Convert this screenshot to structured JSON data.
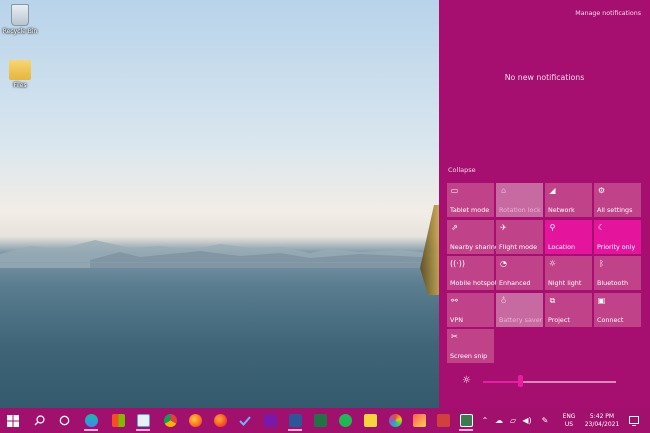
{
  "desktop": {
    "icons": [
      {
        "label": "Recycle Bin"
      },
      {
        "label": "Files"
      }
    ]
  },
  "action_center": {
    "manage_link": "Manage notifications",
    "empty_message": "No new notifications",
    "collapse_label": "Collapse",
    "tiles": [
      {
        "label": "Tablet mode",
        "icon": "tablet-mode-icon",
        "state": "off"
      },
      {
        "label": "Rotation lock",
        "icon": "rotation-lock-icon",
        "state": "disabled"
      },
      {
        "label": "Network",
        "icon": "network-icon",
        "state": "off"
      },
      {
        "label": "All settings",
        "icon": "gear-icon",
        "state": "off"
      },
      {
        "label": "Nearby sharing",
        "icon": "nearby-sharing-icon",
        "state": "off"
      },
      {
        "label": "Flight mode",
        "icon": "airplane-icon",
        "state": "off"
      },
      {
        "label": "Location",
        "icon": "location-icon",
        "state": "on"
      },
      {
        "label": "Priority only",
        "icon": "moon-icon",
        "state": "on"
      },
      {
        "label": "Mobile hotspot",
        "icon": "hotspot-icon",
        "state": "off"
      },
      {
        "label": "Enhanced",
        "icon": "battery-enhanced-icon",
        "state": "off"
      },
      {
        "label": "Night light",
        "icon": "sun-icon",
        "state": "off"
      },
      {
        "label": "Bluetooth",
        "icon": "bluetooth-icon",
        "state": "off"
      },
      {
        "label": "VPN",
        "icon": "vpn-icon",
        "state": "off"
      },
      {
        "label": "Battery saver",
        "icon": "battery-saver-icon",
        "state": "disabled"
      },
      {
        "label": "Project",
        "icon": "project-icon",
        "state": "off"
      },
      {
        "label": "Connect",
        "icon": "connect-icon",
        "state": "off"
      },
      {
        "label": "Screen snip",
        "icon": "screen-snip-icon",
        "state": "off"
      }
    ],
    "brightness_level": 0.28
  },
  "taskbar": {
    "language_top": "ENG",
    "language_bottom": "US",
    "time": "5:42 PM",
    "date": "23/04/2021",
    "colors": {
      "accent": "#a1106d",
      "panel": "#a60f6f"
    }
  }
}
